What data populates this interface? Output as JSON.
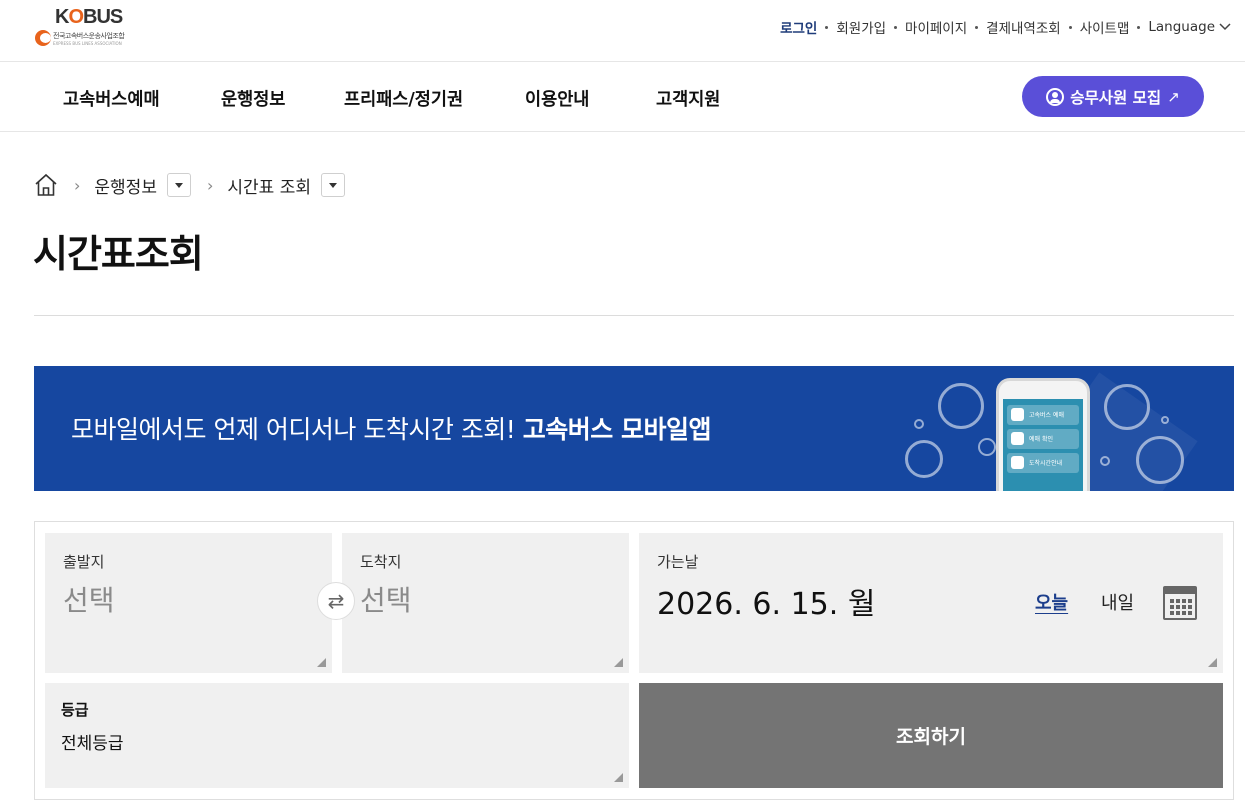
{
  "logo": {
    "word": "KOBUS",
    "subtitle": "전국고속버스운송사업조합",
    "subtitle_en": "EXPRESS BUS LINES ASSOCIATION"
  },
  "util_links": [
    "로그인",
    "회원가입",
    "마이페이지",
    "결제내역조회",
    "사이트맵"
  ],
  "language_label": "Language",
  "gnb": [
    "고속버스예매",
    "운행정보",
    "프리패스/정기권",
    "이용안내",
    "고객지원"
  ],
  "recruit_button": "승무사원 모집",
  "breadcrumb": {
    "level1": "운행정보",
    "level2": "시간표 조회"
  },
  "page_title": "시간표조회",
  "banner": {
    "text": "모바일에서도 언제 어디서나 도착시간 조회!",
    "text_bold": "고속버스 모바일앱",
    "phone_rows": [
      "고속버스 예매",
      "예매 확인",
      "도착시간안내"
    ]
  },
  "form": {
    "departure_label": "출발지",
    "departure_placeholder": "선택",
    "arrival_label": "도착지",
    "arrival_placeholder": "선택",
    "date_label": "가는날",
    "date_value": "2026. 6. 15. 월",
    "today_label": "오늘",
    "tomorrow_label": "내일",
    "grade_label": "등급",
    "grade_value": "전체등급",
    "submit_label": "조회하기"
  },
  "colors": {
    "brand_blue": "#1647a0",
    "recruit_purple": "#5a4fd8",
    "logo_orange": "#e8631c",
    "submit_gray": "#747474"
  }
}
